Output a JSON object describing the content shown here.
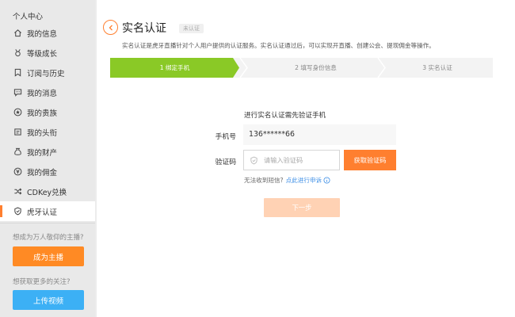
{
  "sidebar": {
    "title": "个人中心",
    "items": [
      {
        "label": "我的信息",
        "icon": "home-icon"
      },
      {
        "label": "等级成长",
        "icon": "medal-icon"
      },
      {
        "label": "订阅与历史",
        "icon": "bookmark-icon"
      },
      {
        "label": "我的消息",
        "icon": "message-icon"
      },
      {
        "label": "我的贵族",
        "icon": "star-icon"
      },
      {
        "label": "我的头衔",
        "icon": "title-icon"
      },
      {
        "label": "我的财产",
        "icon": "wallet-icon"
      },
      {
        "label": "我的佣金",
        "icon": "commission-icon"
      },
      {
        "label": "CDKey兑换",
        "icon": "shuffle-icon"
      },
      {
        "label": "虎牙认证",
        "icon": "shield-icon",
        "active": true
      }
    ],
    "promo1": "想成为万人敬仰的主播?",
    "btn1": "成为主播",
    "promo2": "想获取更多的关注?",
    "btn2": "上传视频"
  },
  "header": {
    "title": "实名认证",
    "badge": "未认证",
    "intro": "实名认证是虎牙直播针对个人用户提供的认证服务。实名认证通过后，可以实现开直播、创建公会、提现佣金等操作。"
  },
  "steps": [
    "1 绑定手机",
    "2 填写身份信息",
    "3 实名认证"
  ],
  "form": {
    "title": "进行实名认证需先验证手机",
    "phone_label": "手机号",
    "phone_value": "136******66",
    "code_label": "验证码",
    "code_placeholder": "请输入验证码",
    "get_code": "获取验证码",
    "help_text": "无法收到短信?",
    "help_link": "点此进行申诉",
    "next": "下一步"
  },
  "colors": {
    "accent": "#ff7f2f",
    "step_active": "#8ac926",
    "blue": "#3cb0f5",
    "link": "#3c8ee6"
  }
}
